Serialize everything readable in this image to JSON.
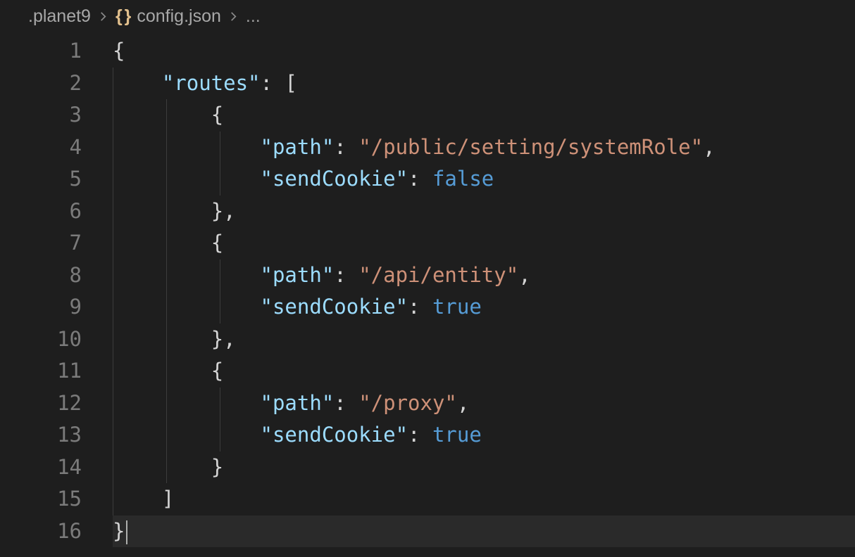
{
  "breadcrumbs": {
    "folder": ".planet9",
    "file": "config.json",
    "overflow": "..."
  },
  "icons": {
    "braces": "{ }"
  },
  "lineNumbers": [
    "1",
    "2",
    "3",
    "4",
    "5",
    "6",
    "7",
    "8",
    "9",
    "10",
    "11",
    "12",
    "13",
    "14",
    "15",
    "16"
  ],
  "code": {
    "l1": "{",
    "l2_key": "\"routes\"",
    "l2_colon": ": [",
    "l3": "{",
    "l4_key": "\"path\"",
    "l4_colon": ": ",
    "l4_val": "\"/public/setting/systemRole\"",
    "l4_comma": ",",
    "l5_key": "\"sendCookie\"",
    "l5_colon": ": ",
    "l5_val": "false",
    "l6": "},",
    "l7": "{",
    "l8_key": "\"path\"",
    "l8_colon": ": ",
    "l8_val": "\"/api/entity\"",
    "l8_comma": ",",
    "l9_key": "\"sendCookie\"",
    "l9_colon": ": ",
    "l9_val": "true",
    "l10": "},",
    "l11": "{",
    "l12_key": "\"path\"",
    "l12_colon": ": ",
    "l12_val": "\"/proxy\"",
    "l12_comma": ",",
    "l13_key": "\"sendCookie\"",
    "l13_colon": ": ",
    "l13_val": "true",
    "l14": "}",
    "l15": "]",
    "l16": "}"
  },
  "file_content": {
    "routes": [
      {
        "path": "/public/setting/systemRole",
        "sendCookie": false
      },
      {
        "path": "/api/entity",
        "sendCookie": true
      },
      {
        "path": "/proxy",
        "sendCookie": true
      }
    ]
  }
}
